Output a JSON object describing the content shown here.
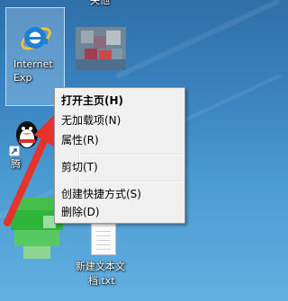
{
  "desktop": {
    "top_partial_label": "失他",
    "icons": {
      "ie": {
        "label_line1": "Internet",
        "label_line2": "Exp"
      },
      "qq": {
        "label": "腾"
      },
      "text_file": {
        "label_line1": "新建文本文",
        "label_line2": "档.txt"
      }
    }
  },
  "context_menu": {
    "items": [
      {
        "label": "打开主页(H)"
      },
      {
        "label": "无加载项(N)"
      },
      {
        "label": "属性(R)"
      },
      {
        "label": "剪切(T)"
      },
      {
        "label": "创建快捷方式(S)"
      },
      {
        "label": "删除(D)"
      }
    ]
  },
  "colors": {
    "arrow": "#e8322c",
    "menu_bg": "#f0f0f0"
  }
}
